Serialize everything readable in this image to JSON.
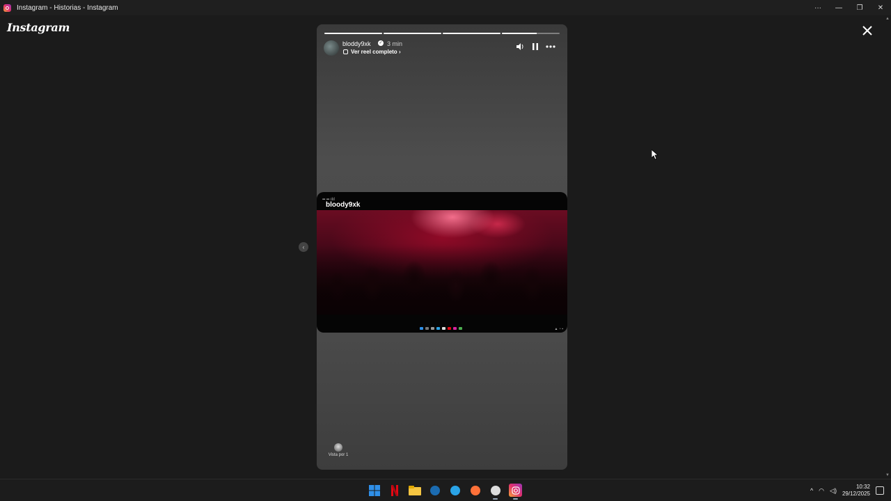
{
  "window": {
    "title": "Instagram - Historias - Instagram",
    "controls": [
      "···",
      "—",
      "❐",
      "✕"
    ]
  },
  "app": {
    "logo": "Instagram",
    "close_label": "✕"
  },
  "story": {
    "progress": [
      1.0,
      1.0,
      1.0,
      0.6
    ],
    "username": "bloddy9xk",
    "time": "3 min",
    "reel_link": "Ver reel completo",
    "reel_link_arrow": "›",
    "media_username": "bloody9xk",
    "viewers_label": "Vista por 1"
  },
  "taskbar": {
    "apps": [
      {
        "name": "start-icon",
        "color": "#2f8fe8"
      },
      {
        "name": "netflix-icon",
        "color": "#e50914"
      },
      {
        "name": "file-explorer-icon",
        "color": "#f5c542"
      },
      {
        "name": "steam-icon",
        "color": "#1b6bb0"
      },
      {
        "name": "safari-icon",
        "color": "#2aa3e6"
      },
      {
        "name": "firefox-icon",
        "color": "#ff7139"
      },
      {
        "name": "chatgpt-icon",
        "color": "#dddddd"
      },
      {
        "name": "instagram-icon",
        "color": "#d6249f"
      }
    ],
    "time": "10:32",
    "date": "29/12/2025"
  }
}
